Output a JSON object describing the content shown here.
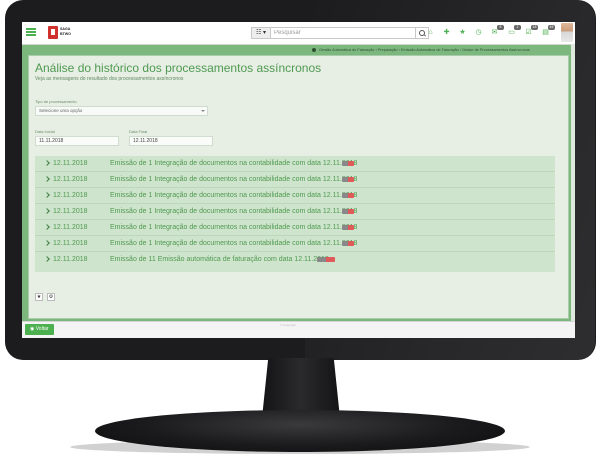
{
  "app": {
    "logo_line1": "SAGA",
    "logo_line2": "BTWO"
  },
  "search": {
    "placeholder": "Pesquisar",
    "toggle_label": "☷ ▾"
  },
  "toolbar": {
    "icons": [
      "home-icon",
      "plus-icon",
      "star-icon",
      "history-icon",
      "messages-icon",
      "documents-icon",
      "tasks-icon",
      "chat-icon"
    ],
    "badges": [
      "8",
      "2",
      "18",
      "45"
    ]
  },
  "breadcrumb": {
    "text": "Gestão Automática de Faturação › Preparação › Emissão Automática de Faturação › Gestor de Processamentos Assíncronos"
  },
  "page": {
    "title": "Análise do histórico dos processamentos assíncronos",
    "subtitle": "Veja as mensagens do resultado dos processamentos assíncronos"
  },
  "filters": {
    "process_type_label": "Tipo de processamento",
    "process_type_value": "Selecione uma opção",
    "date_start_label": "Data Inicial",
    "date_start_value": "11.11.2018",
    "date_end_label": "Data Final",
    "date_end_value": "12.11.2018"
  },
  "results": [
    {
      "date": "12.11.2018",
      "description": "Emissão de 1 Integração de documentos na contabilidade com data 12.11.2018"
    },
    {
      "date": "12.11.2018",
      "description": "Emissão de 1 Integração de documentos na contabilidade com data 12.11.2018"
    },
    {
      "date": "12.11.2018",
      "description": "Emissão de 1 Integração de documentos na contabilidade com data 12.11.2018"
    },
    {
      "date": "12.11.2018",
      "description": "Emissão de 1 Integração de documentos na contabilidade com data 12.11.2018"
    },
    {
      "date": "12.11.2018",
      "description": "Emissão de 1 Integração de documentos na contabilidade com data 12.11.2018"
    },
    {
      "date": "12.11.2018",
      "description": "Emissão de 1 Integração de documentos na contabilidade com data 12.11.2018"
    },
    {
      "date": "12.11.2018",
      "description": "Emissão de 11 Emissão automática de faturação com data 12.11.2018"
    }
  ],
  "tools": {
    "star_label": "★",
    "settings_label": "⚙"
  },
  "footer": {
    "back_label": "◉ Voltar",
    "copyright": "© Copyright"
  },
  "colors": {
    "accent": "#4caf50",
    "frame": "#7cb87e",
    "row_bg": "#cfe4cc",
    "badge_red": "#e05a5a"
  }
}
